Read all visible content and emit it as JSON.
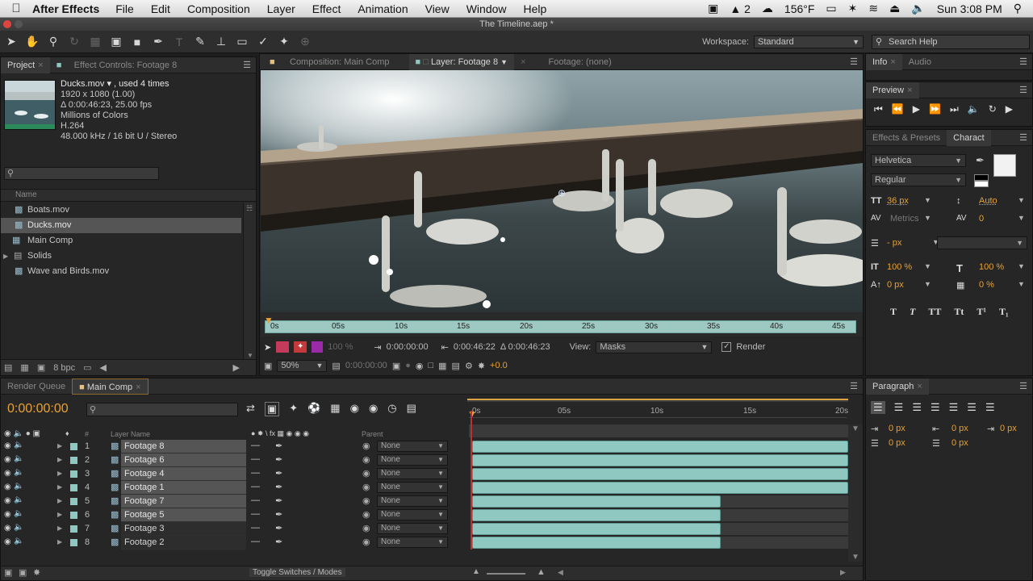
{
  "menubar": {
    "app": "After Effects",
    "items": [
      "File",
      "Edit",
      "Composition",
      "Layer",
      "Effect",
      "Animation",
      "View",
      "Window",
      "Help"
    ],
    "status": {
      "notification_count": "2",
      "weather": "156°F",
      "clock": "Sun 3:08 PM"
    }
  },
  "window": {
    "title": "The Timeline.aep *"
  },
  "toolbar": {
    "workspace_label": "Workspace:",
    "workspace_value": "Standard",
    "search_placeholder": "Search Help"
  },
  "project": {
    "tabs": [
      "Project",
      "Effect Controls: Footage 8"
    ],
    "preview_info": {
      "name": "Ducks.mov ▾ , used 4 times",
      "resolution": "1920 x 1080 (1.00)",
      "duration": "Δ 0:00:46:23, 25.00 fps",
      "colors": "Millions of Colors",
      "codec": "H.264",
      "audio": "48.000 kHz / 16 bit U / Stereo"
    },
    "column_name": "Name",
    "items": [
      "Boats.mov",
      "Ducks.mov",
      "Main Comp",
      "Solids",
      "Wave and Birds.mov"
    ],
    "bpc": "8 bpc"
  },
  "viewer": {
    "tabs": [
      "Composition: Main Comp",
      "Layer: Footage 8",
      "Footage: (none)"
    ],
    "ruler_ticks": [
      "0s",
      "05s",
      "10s",
      "15s",
      "20s",
      "25s",
      "30s",
      "35s",
      "40s",
      "45s"
    ],
    "opacity": "100 %",
    "in_time": "0:00:00:00",
    "out_time": "0:00:46:22",
    "duration": "Δ 0:00:46:23",
    "view_label": "View:",
    "view_value": "Masks",
    "render_label": "Render",
    "zoom": "50%",
    "current_time": "0:00:00:00",
    "exposure": "+0.0"
  },
  "info": {
    "tabs": [
      "Info",
      "Audio"
    ]
  },
  "preview": {
    "tab": "Preview"
  },
  "character": {
    "tabs": [
      "Effects & Presets",
      "Charact"
    ],
    "font": "Helvetica",
    "style": "Regular",
    "size": "36 px",
    "leading": "Auto",
    "kerning": "Metrics",
    "tracking": "0",
    "stroke": "- px",
    "vscale": "100 %",
    "hscale": "100 %",
    "baseline": "0 px",
    "tsume": "0 %",
    "styles": [
      "T",
      "T",
      "TT",
      "Tt",
      "T¹",
      "T₁"
    ]
  },
  "timeline": {
    "tabs": [
      "Render Queue",
      "Main Comp"
    ],
    "current_time": "0:00:00:00",
    "column_layer_name": "Layer Name",
    "column_parent": "Parent",
    "ruler_ticks": [
      "0s",
      "05s",
      "10s",
      "15s",
      "20s"
    ],
    "layers": [
      {
        "num": "1",
        "name": "Footage 8",
        "parent": "None",
        "selected": true,
        "end": 1.0
      },
      {
        "num": "2",
        "name": "Footage 6",
        "parent": "None",
        "selected": true,
        "end": 1.0
      },
      {
        "num": "3",
        "name": "Footage 4",
        "parent": "None",
        "selected": true,
        "end": 1.0
      },
      {
        "num": "4",
        "name": "Footage 1",
        "parent": "None",
        "selected": true,
        "end": 1.0
      },
      {
        "num": "5",
        "name": "Footage 7",
        "parent": "None",
        "selected": true,
        "end": 0.66
      },
      {
        "num": "6",
        "name": "Footage 5",
        "parent": "None",
        "selected": true,
        "end": 0.66
      },
      {
        "num": "7",
        "name": "Footage 3",
        "parent": "None",
        "selected": false,
        "end": 0.66
      },
      {
        "num": "8",
        "name": "Footage 2",
        "parent": "None",
        "selected": false,
        "end": 0.66
      }
    ],
    "toggle_label": "Toggle Switches / Modes"
  },
  "paragraph": {
    "tab": "Paragraph",
    "indent_left": "0 px",
    "indent_right": "0 px",
    "indent_first": "0 px",
    "space_before": "0 px",
    "space_after": "0 px"
  }
}
